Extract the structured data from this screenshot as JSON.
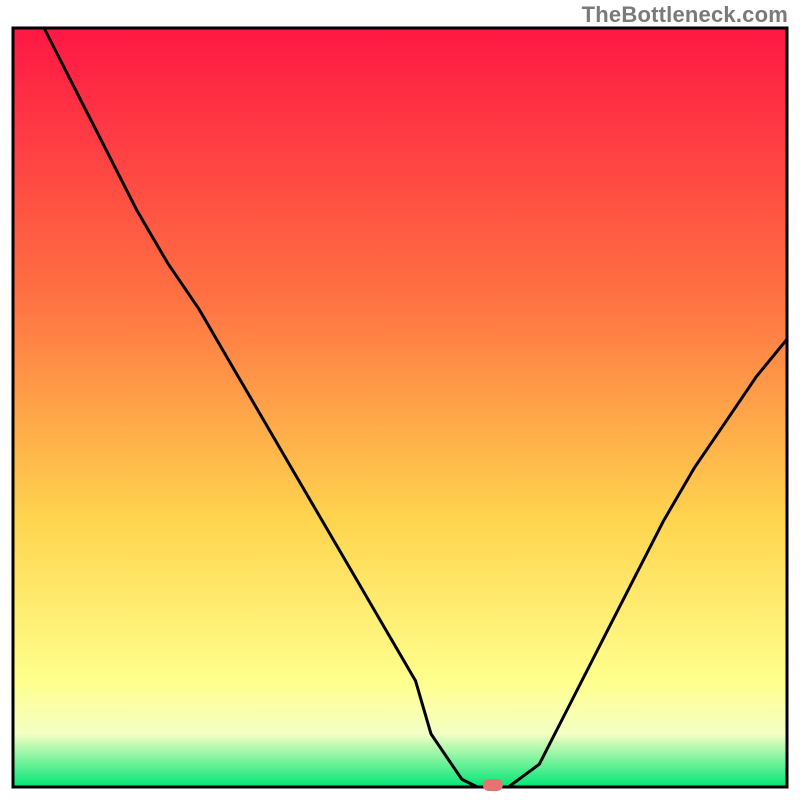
{
  "watermark": "TheBottleneck.com",
  "chart_data": {
    "type": "line",
    "title": "",
    "xlabel": "",
    "ylabel": "",
    "xlim": [
      0,
      100
    ],
    "ylim": [
      0,
      100
    ],
    "x": [
      4,
      8,
      12,
      16,
      20,
      24,
      28,
      32,
      36,
      40,
      44,
      48,
      52,
      54,
      58,
      60,
      64,
      68,
      72,
      76,
      80,
      84,
      88,
      92,
      96,
      100
    ],
    "y": [
      100,
      92,
      84,
      76,
      69,
      63,
      56,
      49,
      42,
      35,
      28,
      21,
      14,
      7,
      1,
      0,
      0,
      3,
      11,
      19,
      27,
      35,
      42,
      48,
      54,
      59
    ],
    "marker": {
      "x": 62,
      "y": 0
    },
    "annotations": []
  },
  "colors": {
    "gradient_top": "#ff1744",
    "gradient_mid1": "#ff7043",
    "gradient_mid2": "#ffd54f",
    "gradient_band_light": "#ffff8d",
    "gradient_band_paler": "#f4ffc4",
    "gradient_bottom": "#00e676",
    "marker": "#e57373",
    "frame": "#000000",
    "curve": "#000000"
  }
}
